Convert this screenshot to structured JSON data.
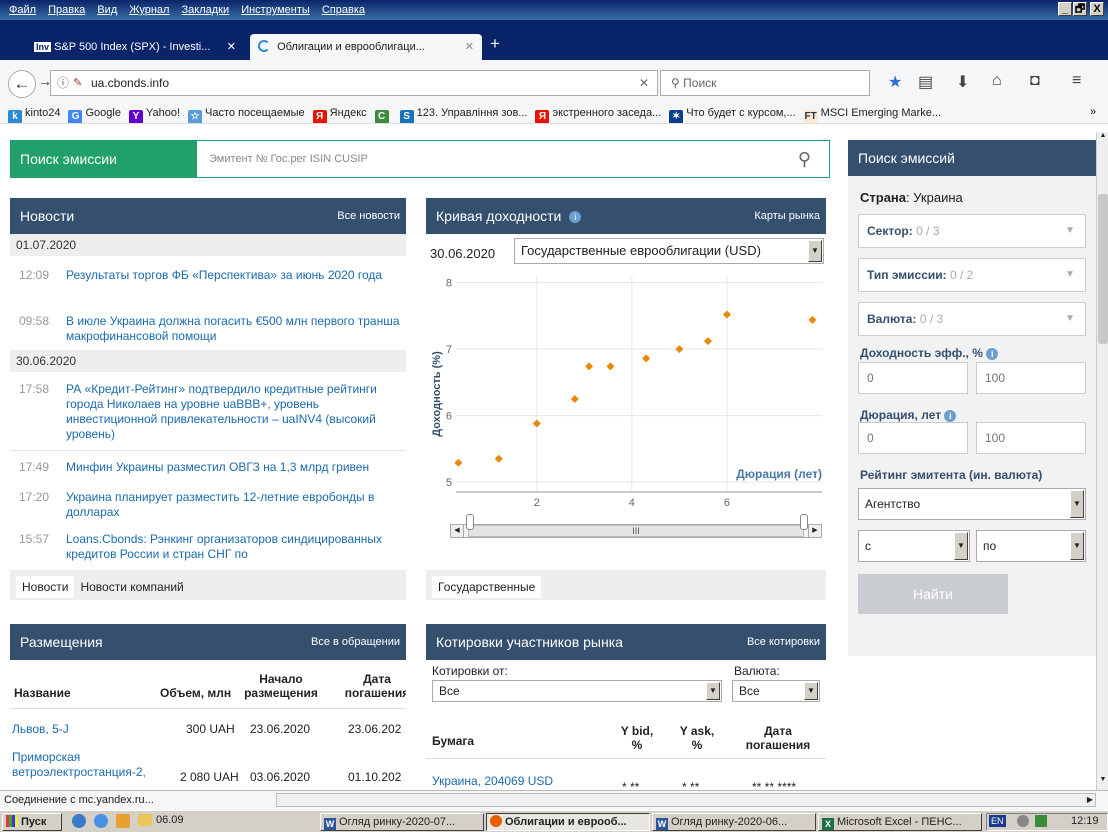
{
  "menu": [
    "Файл",
    "Правка",
    "Вид",
    "Журнал",
    "Закладки",
    "Инструменты",
    "Справка"
  ],
  "window_controls": [
    "_",
    "🗗",
    "X"
  ],
  "tabs": [
    {
      "label": "S&P 500 Index (SPX) - Investi...",
      "icon": "Inv"
    },
    {
      "label": "Облигации и еврооблигаци...",
      "icon": "loading"
    }
  ],
  "url": "ua.cbonds.info",
  "search_placeholder": "Поиск",
  "bookmarks": [
    {
      "label": "kinto24",
      "color": "#2a8ad4",
      "icon": "k"
    },
    {
      "label": "Google",
      "color": "#4285f4",
      "icon": "G"
    },
    {
      "label": "Yahoo!",
      "color": "#5f01d1",
      "icon": "Y"
    },
    {
      "label": "Часто посещаемые",
      "color": "#5b9bd5",
      "icon": "☆"
    },
    {
      "label": "Яндекс",
      "color": "#e61400",
      "icon": "Я"
    },
    {
      "label": "",
      "color": "#3c8c3c",
      "icon": "C"
    },
    {
      "label": "123. Управління зов...",
      "color": "#1a73b8",
      "icon": "S"
    },
    {
      "label": "экстренного заседа...",
      "color": "#e61400",
      "icon": "Я"
    },
    {
      "label": "Что будет с курсом,...",
      "color": "#0c3e8c",
      "icon": "✶"
    },
    {
      "label": "MSCI Emerging Marke...",
      "color": "#fbe7d4",
      "icon": "FT"
    }
  ],
  "bookmarks_more": "»",
  "search_issue": {
    "title": "Поиск эмиссии",
    "placeholder": "Эмитент № Гос.рег ISIN CUSIP"
  },
  "news": {
    "title": "Новости",
    "all_link": "Все новости",
    "groups": [
      {
        "date": "01.07.2020",
        "items": [
          {
            "time": "12:09",
            "text": "Результаты торгов ФБ «Перспектива» за июнь 2020 года"
          },
          {
            "time": "09:58",
            "text": "В июле Украина должна погасить €500 млн первого транша макрофинансовой помощи"
          }
        ]
      },
      {
        "date": "30.06.2020",
        "items": [
          {
            "time": "17:58",
            "text": "РА «Кредит-Рейтинг» подтвердило кредитные рейтинги города Николаев на уровне uaBBB+, уровень инвестиционной привлекательности – uaINV4 (высокий уровень)"
          },
          {
            "time": "17:49",
            "text": "Минфин Украины разместил ОВГЗ на 1,3 млрд гривен"
          },
          {
            "time": "17:20",
            "text": "Украина планирует разместить 12-летние евробонды в долларах"
          },
          {
            "time": "15:57",
            "text": "Loans.Cbonds: Рэнкинг организаторов синдицированных кредитов России и стран СНГ по"
          }
        ]
      }
    ],
    "tabs": [
      "Новости",
      "Новости компаний"
    ]
  },
  "yield_curve": {
    "title": "Кривая доходности",
    "maps_link": "Карты рынка",
    "date": "30.06.2020",
    "selected": "Государственные еврооблигации (USD)",
    "bottom_tab": "Государственные",
    "scroll_thumb": "III"
  },
  "chart_data": {
    "type": "scatter",
    "ylabel": "Доходность (%)",
    "xlabel": "Дюрация (лет)",
    "xlim": [
      0.3,
      8.0
    ],
    "ylim": [
      4.85,
      8.1
    ],
    "xticks": [
      2,
      4,
      6
    ],
    "yticks": [
      5,
      6,
      7,
      8
    ],
    "color": "#e8890c",
    "points": [
      [
        0.35,
        5.29
      ],
      [
        1.2,
        5.35
      ],
      [
        2.0,
        5.88
      ],
      [
        2.8,
        6.25
      ],
      [
        3.1,
        6.74
      ],
      [
        3.55,
        6.74
      ],
      [
        4.3,
        6.86
      ],
      [
        5.0,
        7.0
      ],
      [
        5.6,
        7.12
      ],
      [
        6.0,
        7.52
      ],
      [
        7.8,
        7.44
      ]
    ]
  },
  "placements": {
    "title": "Размещения",
    "all_link": "Все в обращении",
    "headers": [
      "Название",
      "Объем, млн",
      "Начало размещения",
      "Дата погашения"
    ],
    "rows": [
      {
        "name": "Львов, 5-J",
        "volume": "300 UAH",
        "start": "23.06.2020",
        "maturity": "23.06.202"
      },
      {
        "name": "Приморская ветроэлектростанция-2,",
        "volume": "2 080 UAH",
        "start": "03.06.2020",
        "maturity": "01.10.202"
      }
    ]
  },
  "quotes": {
    "title": "Котировки участников рынка",
    "all_link": "Все котировки",
    "from_label": "Котировки от:",
    "from_value": "Все",
    "currency_label": "Валюта:",
    "currency_value": "Все",
    "headers": [
      "Бумага",
      "Y bid, %",
      "Y ask, %",
      "Дата погашения"
    ],
    "rows": [
      {
        "name": "Украина, 204069 USD",
        "bid": "* **",
        "ask": "* **",
        "maturity": "** ** ****"
      }
    ]
  },
  "sidebar": {
    "title": "Поиск эмиссий",
    "country_label": "Страна",
    "country_value": "Украина",
    "sector": {
      "label": "Сектор:",
      "value": "0 / 3"
    },
    "issue_type": {
      "label": "Тип эмиссии:",
      "value": "0 / 2"
    },
    "currency": {
      "label": "Валюта:",
      "value": "0 / 3"
    },
    "yield_label": "Доходность эфф., %",
    "yield_from": "0",
    "yield_to": "100",
    "duration_label": "Дюрация, лет",
    "duration_from": "0",
    "duration_to": "100",
    "rating_label": "Рейтинг эмитента (ин. валюта)",
    "agency": "Агентство",
    "from": "с",
    "to": "по",
    "find_button": "Найти"
  },
  "status_text": "Соединение с mc.yandex.ru...",
  "taskbar": {
    "start": "Пуск",
    "folder": "06.09",
    "buttons": [
      "Огляд ринку-2020-07...",
      "Облигации и еврооб...",
      "Огляд ринку-2020-06...",
      "Microsoft Excel - ПЕНС..."
    ],
    "lang": "EN",
    "clock": "12:19"
  }
}
